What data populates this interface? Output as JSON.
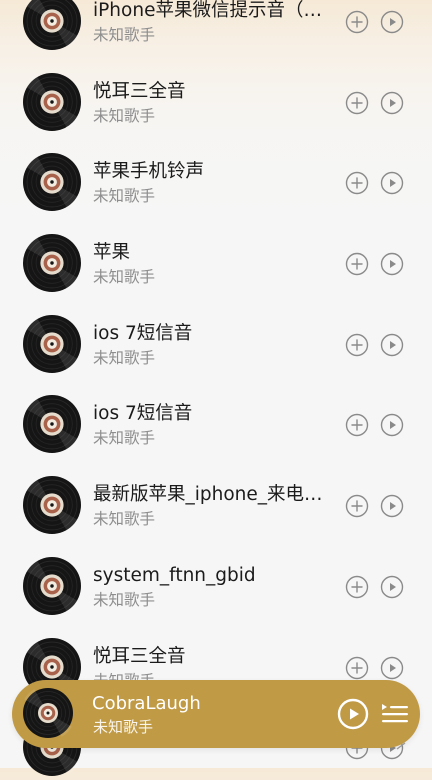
{
  "songs": [
    {
      "title": "iPhone苹果微信提示音（叮咚~~）",
      "artist": "未知歌手"
    },
    {
      "title": "悦耳三全音",
      "artist": "未知歌手"
    },
    {
      "title": "苹果手机铃声",
      "artist": "未知歌手"
    },
    {
      "title": "苹果",
      "artist": "未知歌手"
    },
    {
      "title": "ios 7短信音",
      "artist": "未知歌手"
    },
    {
      "title": "ios 7短信音",
      "artist": "未知歌手"
    },
    {
      "title": "最新版苹果_iphone_来电铃声",
      "artist": "未知歌手"
    },
    {
      "title": "system_ftnn_gbid",
      "artist": "未知歌手"
    },
    {
      "title": "悦耳三全音",
      "artist": "未知歌手"
    },
    {
      "title": "",
      "artist": ""
    }
  ],
  "player": {
    "title": "CobraLaugh",
    "artist": "未知歌手",
    "background": "#c09a45"
  },
  "icons": {
    "album": "vinyl-record-icon",
    "add": "plus-circle-icon",
    "play": "play-circle-icon",
    "playlist": "playlist-icon"
  },
  "colors": {
    "title": "#1b1b1b",
    "subtitle": "#8e8e8e",
    "icon": "#8a8a8a"
  }
}
